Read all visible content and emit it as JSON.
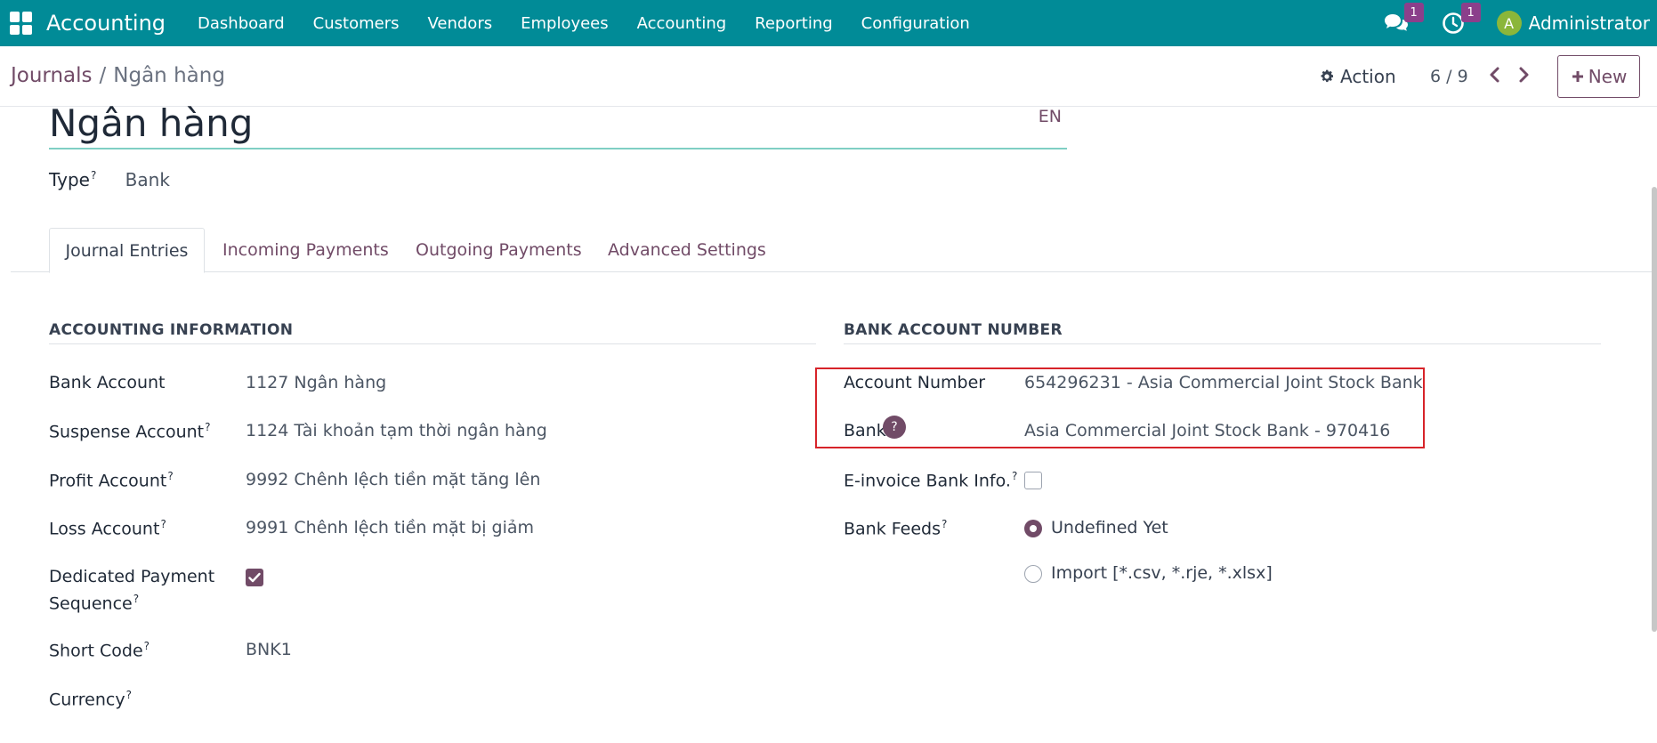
{
  "navbar": {
    "app_title": "Accounting",
    "menu": [
      "Dashboard",
      "Customers",
      "Vendors",
      "Employees",
      "Accounting",
      "Reporting",
      "Configuration"
    ],
    "messages_badge": "1",
    "activities_badge": "1",
    "avatar_initial": "A",
    "user_name": "Administrator",
    "bg_color": "#018b97"
  },
  "control_panel": {
    "breadcrumb_parent": "Journals",
    "breadcrumb_separator": "/",
    "breadcrumb_current": "Ngân hàng",
    "action_label": "Action",
    "pager": "6 / 9",
    "new_label": "New"
  },
  "form": {
    "name": "Ngân hàng",
    "lang": "EN",
    "type_label": "Type",
    "type_value": "Bank",
    "help_mark": "?",
    "tabs": [
      "Journal Entries",
      "Incoming Payments",
      "Outgoing Payments",
      "Advanced Settings"
    ],
    "accounting_section": {
      "title": "ACCOUNTING INFORMATION",
      "bank_account_label": "Bank Account",
      "bank_account_value": "1127 Ngân hàng",
      "suspense_label": "Suspense Account",
      "suspense_value": "1124 Tài khoản tạm thời ngân hàng",
      "profit_label": "Profit Account",
      "profit_value": "9992 Chênh lệch tiền mặt tăng lên",
      "loss_label": "Loss Account",
      "loss_value": "9991 Chênh lệch tiền mặt bị giảm",
      "dedicated_label_1": "Dedicated Payment",
      "dedicated_label_2": "Sequence",
      "dedicated_checked": true,
      "short_code_label": "Short Code",
      "short_code_value": "BNK1",
      "currency_label": "Currency"
    },
    "bank_section": {
      "title": "BANK ACCOUNT NUMBER",
      "account_number_label": "Account Number",
      "account_number_value": "654296231 - Asia Commercial Joint Stock Bank",
      "bank_label": "Bank",
      "bank_value": "Asia Commercial Joint Stock Bank - 970416",
      "einvoice_label": "E-invoice Bank Info.",
      "einvoice_checked": false,
      "bank_feeds_label": "Bank Feeds",
      "bank_feeds_options": [
        "Undefined Yet",
        "Import [*.csv, *.rje, *.xlsx]"
      ],
      "bank_feeds_selected": "Undefined Yet"
    }
  },
  "colors": {
    "primary": "#714b67",
    "highlight": "#d7242a"
  }
}
